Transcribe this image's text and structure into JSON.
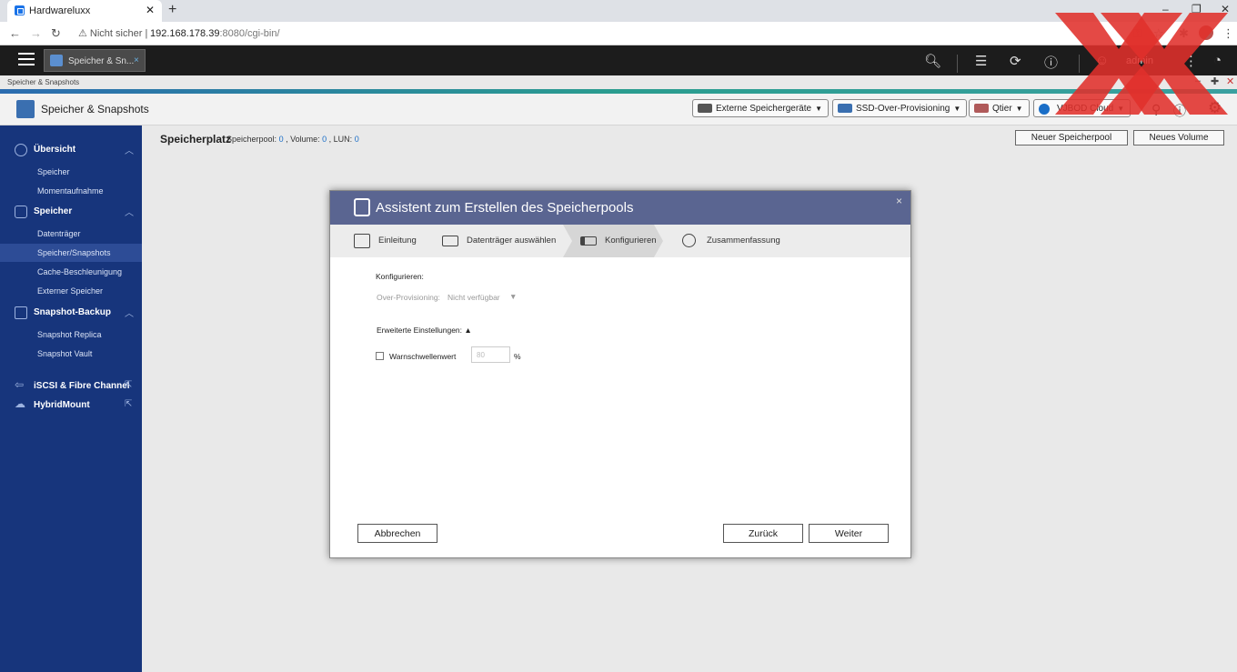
{
  "browser": {
    "tab_title": "Hardwareluxx",
    "tab_close": "✕",
    "new_tab": "+",
    "window_controls": [
      "–",
      "❐",
      "✕"
    ],
    "security": "Nicht sicher",
    "url_host": "192.168.178.39",
    "url_rest": ":8080/cgi-bin/"
  },
  "qts": {
    "app_tab_label": "Speicher & Sn...",
    "app_tab_close": "×",
    "user": "admin",
    "subtitle": "Speicher & Snapshots"
  },
  "app": {
    "title": "Speicher & Snapshots",
    "header_buttons": [
      {
        "label": "Externe Speichergeräte"
      },
      {
        "label": "SSD-Over-Provisioning"
      },
      {
        "label": "Qtier"
      },
      {
        "label": "VJBOD Cloud"
      }
    ]
  },
  "sidebar": {
    "sections": [
      {
        "label": "Übersicht",
        "items": [
          "Speicher",
          "Momentaufnahme"
        ]
      },
      {
        "label": "Speicher",
        "items": [
          "Datenträger",
          "Speicher/Snapshots",
          "Cache-Beschleunigung",
          "Externer Speicher"
        ]
      },
      {
        "label": "Snapshot-Backup",
        "items": [
          "Snapshot Replica",
          "Snapshot Vault"
        ]
      }
    ],
    "links": [
      "iSCSI & Fibre Channel",
      "HybridMount"
    ],
    "active_item": "Speicher/Snapshots"
  },
  "main": {
    "title": "Speicherplatz",
    "pool_label": "Speicherpool:",
    "pool_value": "0",
    "volume_label": ", Volume:",
    "volume_value": "0",
    "lun_label": ", LUN:",
    "lun_value": "0",
    "new_pool_button": "Neuer Speicherpool",
    "new_volume_button": "Neues Volume"
  },
  "dialog": {
    "title": "Assistent zum Erstellen des Speicherpools",
    "close": "×",
    "steps": [
      "Einleitung",
      "Datenträger auswählen",
      "Konfigurieren",
      "Zusammenfassung"
    ],
    "active_step": "Konfigurieren",
    "configure_label": "Konfigurieren:",
    "over_provisioning_label": "Over-Provisioning:",
    "over_provisioning_value": "Nicht verfügbar",
    "over_provisioning_arrow": "▼",
    "advanced_label": "Erweiterte Einstellungen: ▲",
    "warning_label": "Warnschwellenwert",
    "warning_placeholder": "80",
    "warning_unit": "%",
    "cancel_button": "Abbrechen",
    "back_button": "Zurück",
    "next_button": "Weiter"
  },
  "colors": {
    "sidebar_bg": "#17357c",
    "dialog_header": "#5a6591",
    "link_blue": "#1a6ec7",
    "watermark_red": "#e0302b"
  }
}
